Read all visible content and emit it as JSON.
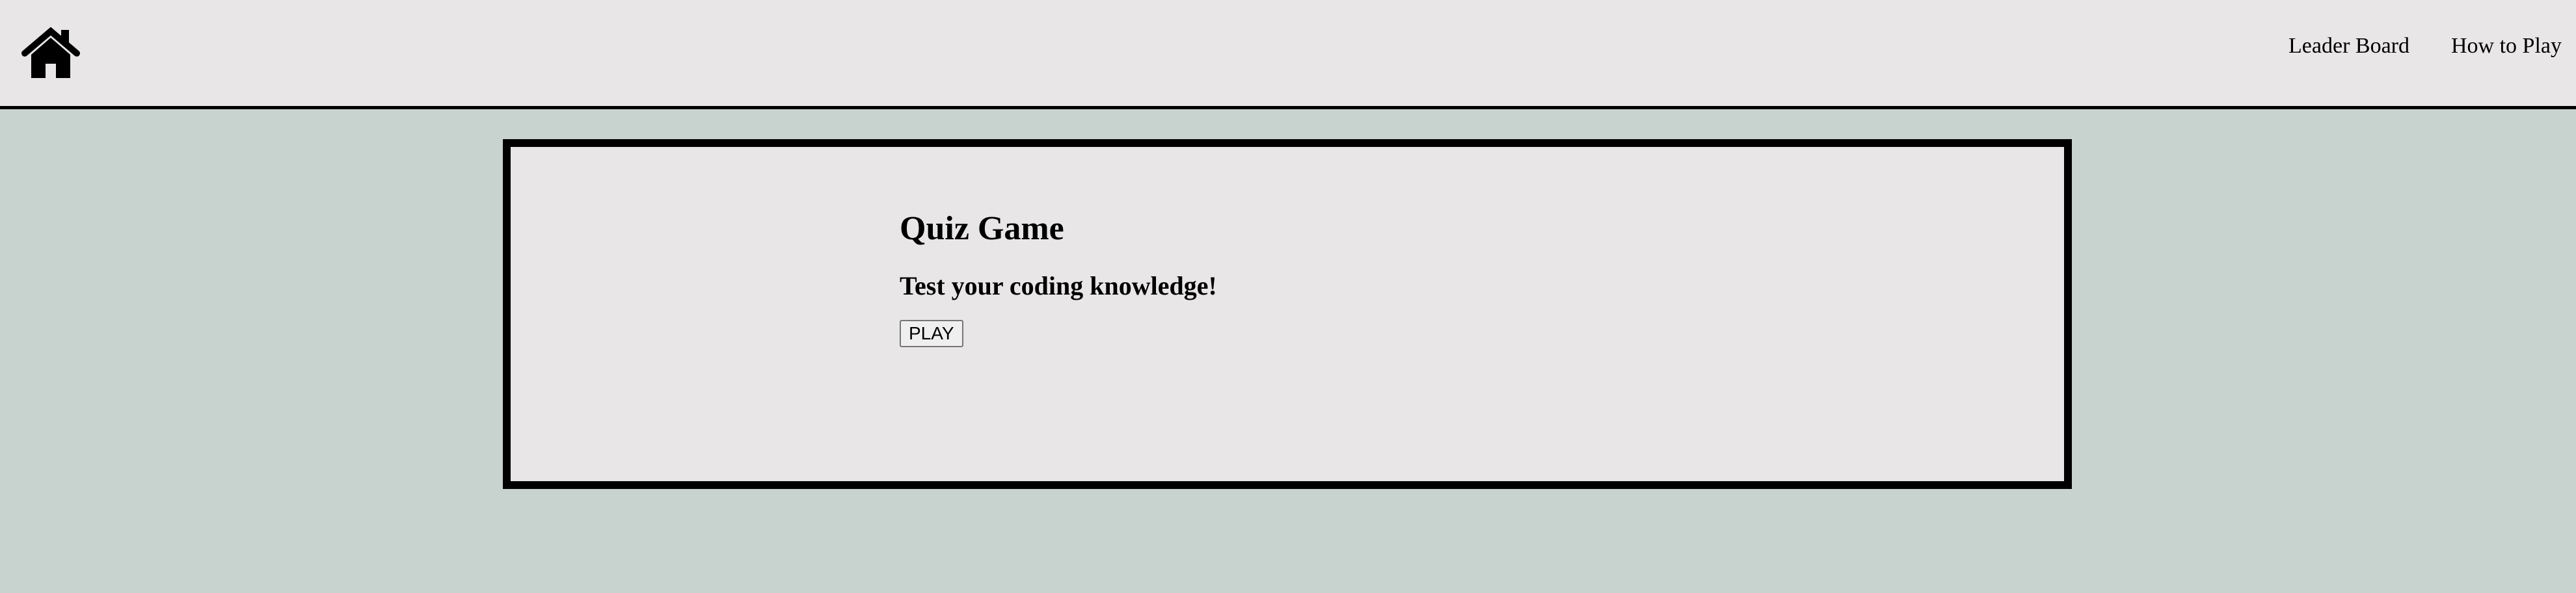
{
  "navbar": {
    "home_icon": "home-icon",
    "links": [
      {
        "label": "Leader Board"
      },
      {
        "label": "How to Play"
      }
    ]
  },
  "quiz": {
    "title": "Quiz Game",
    "subtitle": "Test your coding knowledge!",
    "play_label": "PLAY"
  },
  "colors": {
    "page_background": "#c8d3cf",
    "panel_background": "#e8e6e7",
    "border": "#000000"
  }
}
